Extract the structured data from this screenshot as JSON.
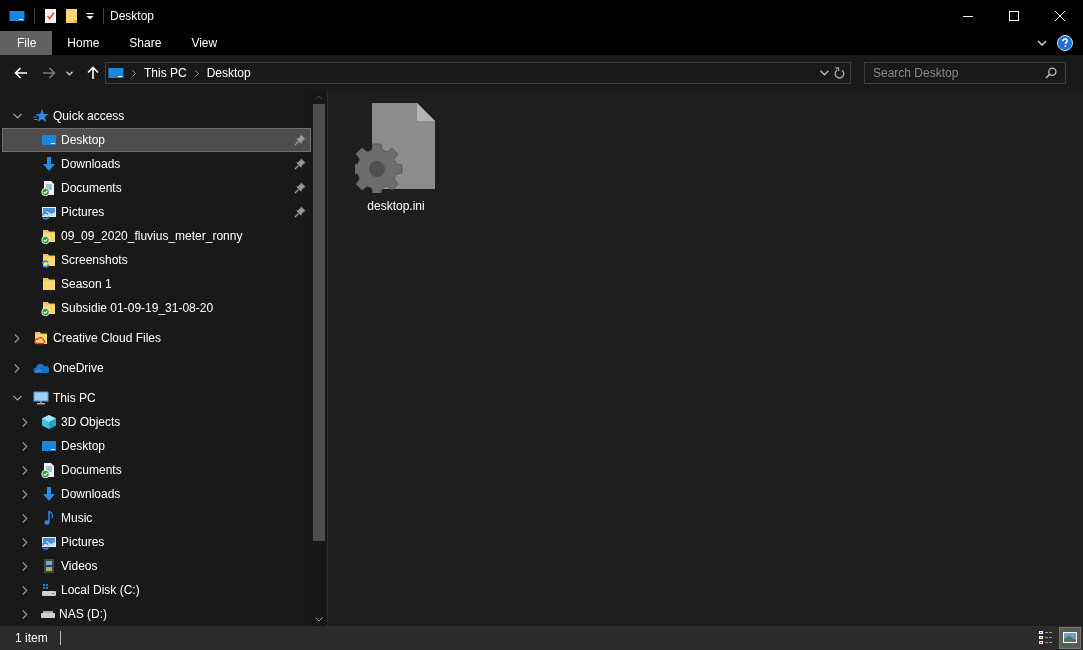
{
  "window": {
    "title": "Desktop"
  },
  "ribbon": {
    "tabs": [
      {
        "label": "File",
        "selected": true
      },
      {
        "label": "Home",
        "selected": false
      },
      {
        "label": "Share",
        "selected": false
      },
      {
        "label": "View",
        "selected": false
      }
    ]
  },
  "navigation": {
    "back_disabled": false,
    "forward_disabled": true
  },
  "address": {
    "breadcrumbs": [
      "This PC",
      "Desktop"
    ]
  },
  "search": {
    "placeholder": "Search Desktop"
  },
  "sidebar": {
    "items": [
      {
        "label": "Quick access",
        "kind": "quick-access",
        "expanded": true,
        "children": [
          {
            "label": "Desktop",
            "kind": "desktop",
            "synced": false,
            "syncing": false,
            "selected": true,
            "pinned": true
          },
          {
            "label": "Downloads",
            "kind": "downloads",
            "synced": false,
            "syncing": false,
            "selected": false,
            "pinned": true
          },
          {
            "label": "Documents",
            "kind": "documents",
            "synced": true,
            "syncing": false,
            "selected": false,
            "pinned": true
          },
          {
            "label": "Pictures",
            "kind": "pictures",
            "synced": false,
            "syncing": true,
            "selected": false,
            "pinned": true
          },
          {
            "label": "09_09_2020_fluvius_meter_ronny",
            "kind": "folder",
            "synced": true,
            "syncing": false,
            "selected": false,
            "pinned": false
          },
          {
            "label": "Screenshots",
            "kind": "folder",
            "synced": false,
            "syncing": true,
            "selected": false,
            "pinned": false
          },
          {
            "label": "Season 1",
            "kind": "folder",
            "synced": false,
            "syncing": false,
            "selected": false,
            "pinned": false
          },
          {
            "label": "Subsidie 01-09-19_31-08-20",
            "kind": "folder",
            "synced": true,
            "syncing": false,
            "selected": false,
            "pinned": false
          }
        ]
      },
      {
        "label": "Creative Cloud Files",
        "kind": "creative-cloud",
        "expanded": false
      },
      {
        "label": "OneDrive",
        "kind": "onedrive",
        "expanded": false
      },
      {
        "label": "This PC",
        "kind": "this-pc",
        "expanded": true,
        "children": [
          {
            "label": "3D Objects",
            "kind": "objects",
            "synced": false,
            "syncing": false,
            "expanded": false
          },
          {
            "label": "Desktop",
            "kind": "desktop",
            "synced": false,
            "syncing": false,
            "expanded": false
          },
          {
            "label": "Documents",
            "kind": "documents",
            "synced": true,
            "syncing": false,
            "expanded": false
          },
          {
            "label": "Downloads",
            "kind": "downloads",
            "synced": false,
            "syncing": false,
            "expanded": false
          },
          {
            "label": "Music",
            "kind": "music",
            "synced": false,
            "syncing": false,
            "expanded": false
          },
          {
            "label": "Pictures",
            "kind": "pictures",
            "synced": false,
            "syncing": true,
            "expanded": false
          },
          {
            "label": "Videos",
            "kind": "videos",
            "synced": false,
            "syncing": false,
            "expanded": false
          },
          {
            "label": "Local Disk (C:)",
            "kind": "disk",
            "synced": false,
            "syncing": false,
            "expanded": false
          },
          {
            "label": "NAS (D:)",
            "kind": "drive",
            "synced": false,
            "syncing": false,
            "expanded": false
          }
        ]
      }
    ]
  },
  "files": [
    {
      "name": "desktop.ini",
      "kind": "settings-file"
    }
  ],
  "status_bar": {
    "item_count": "1 item",
    "views": [
      {
        "kind": "details",
        "selected": false
      },
      {
        "kind": "large-icons",
        "selected": true
      }
    ]
  }
}
